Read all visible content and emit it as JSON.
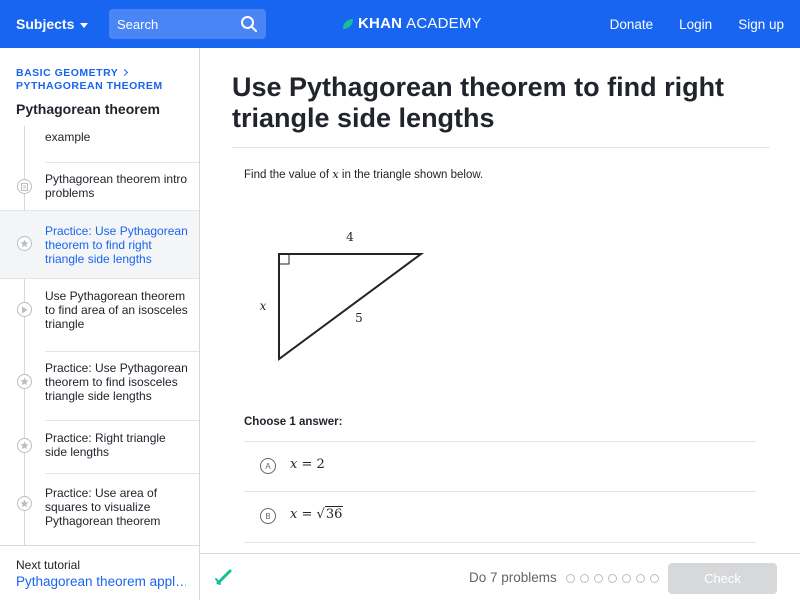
{
  "topbar": {
    "subjects_label": "Subjects",
    "search_placeholder": "Search",
    "logo_bold": "KHAN",
    "logo_light": "ACADEMY",
    "nav": [
      "Donate",
      "Login",
      "Sign up"
    ],
    "brand_color": "#1865f2"
  },
  "sidebar": {
    "breadcrumb_1": "BASIC GEOMETRY",
    "breadcrumb_2": "PYTHAGOREAN THEOREM",
    "title": "Pythagorean theorem",
    "items": [
      {
        "label": "example",
        "icon": "video-icon",
        "active": false
      },
      {
        "label": "Pythagorean theorem intro problems",
        "icon": "article-icon",
        "active": false
      },
      {
        "label": "Practice: Use Pythagorean theorem to find right triangle side lengths",
        "icon": "star-icon",
        "active": true
      },
      {
        "label": "Use Pythagorean theorem to find area of an isosceles triangle",
        "icon": "play-icon",
        "active": false
      },
      {
        "label": "Practice: Use Pythagorean theorem to find isosceles triangle side lengths",
        "icon": "star-icon",
        "active": false
      },
      {
        "label": "Practice: Right triangle side lengths",
        "icon": "star-icon",
        "active": false
      },
      {
        "label": "Practice: Use area of squares to visualize Pythagorean theorem",
        "icon": "star-icon",
        "active": false
      }
    ],
    "next_label": "Next tutorial",
    "next_link": "Pythagorean theorem appl…"
  },
  "main": {
    "title": "Use Pythagorean theorem to find right triangle side lengths",
    "question_pre": "Find the value of ",
    "question_var": "x",
    "question_post": " in the triangle shown below.",
    "triangle_labels": {
      "top": "4",
      "left": "x",
      "hyp": "5"
    },
    "choose_label": "Choose 1 answer:",
    "choices": [
      {
        "letter": "A",
        "lhs": "x",
        "rhs": "2"
      },
      {
        "letter": "B",
        "lhs": "x",
        "rhs": "36",
        "sqrt": true
      }
    ]
  },
  "footer": {
    "do_text": "Do 7 problems",
    "problem_count": 7,
    "check_label": "Check"
  }
}
